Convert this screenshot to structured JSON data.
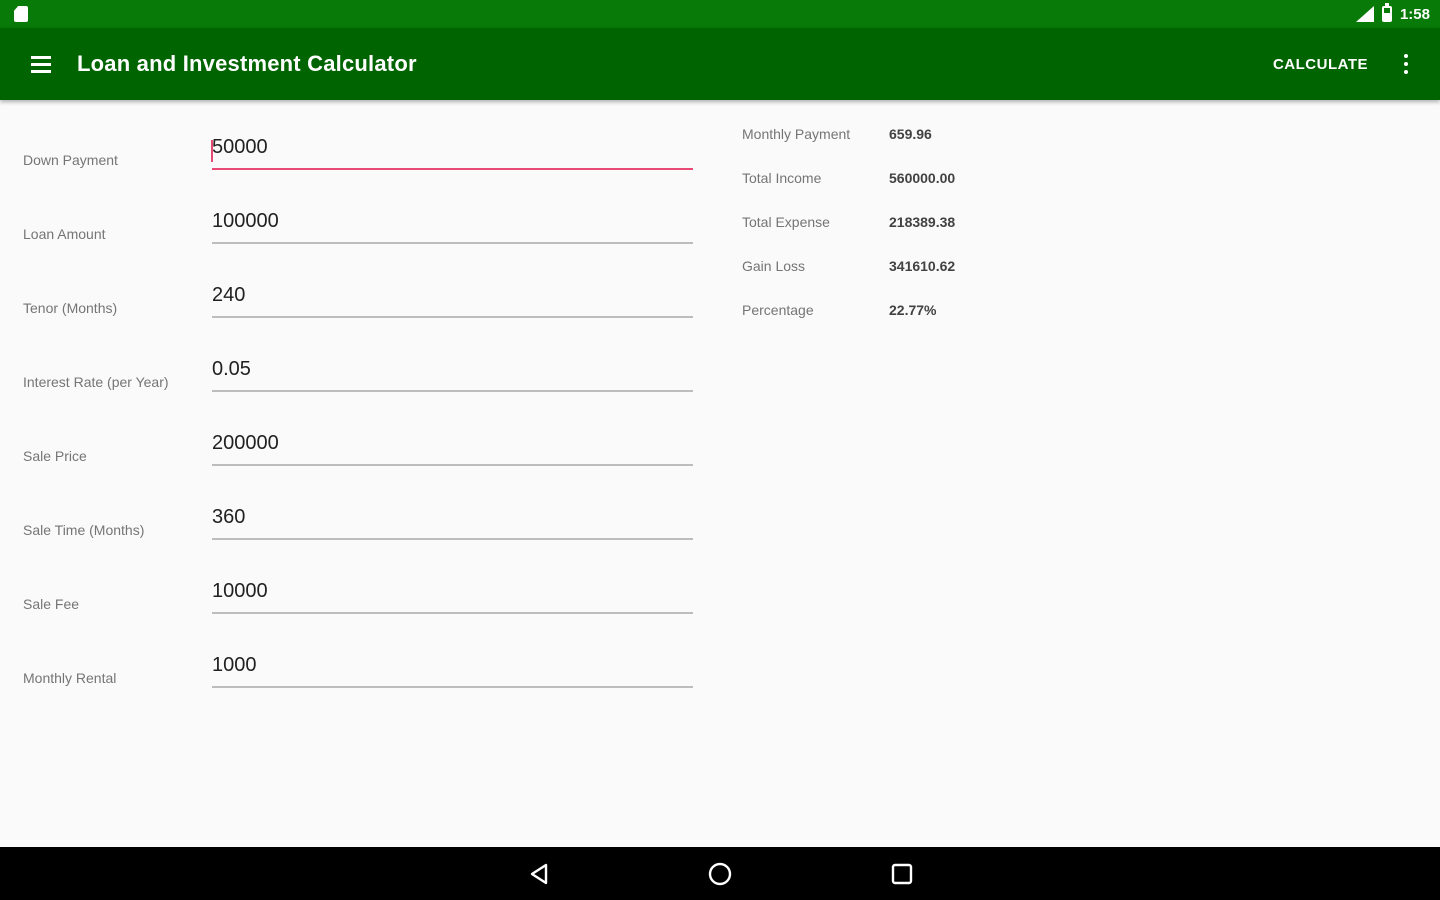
{
  "status_bar": {
    "time": "1:58",
    "icons": [
      "sd-card-icon",
      "signal-icon",
      "battery-icon"
    ]
  },
  "app_bar": {
    "title": "Loan and Investment Calculator",
    "calculate_label": "CALCULATE",
    "icons": [
      "menu-icon",
      "overflow-menu-icon"
    ]
  },
  "form": {
    "fields": [
      {
        "label": "Down Payment",
        "value": "50000"
      },
      {
        "label": "Loan Amount",
        "value": "100000"
      },
      {
        "label": "Tenor (Months)",
        "value": "240"
      },
      {
        "label": "Interest Rate (per Year)",
        "value": "0.05"
      },
      {
        "label": "Sale Price",
        "value": "200000"
      },
      {
        "label": "Sale Time (Months)",
        "value": "360"
      },
      {
        "label": "Sale Fee",
        "value": "10000"
      },
      {
        "label": "Monthly Rental",
        "value": "1000"
      }
    ]
  },
  "results": {
    "rows": [
      {
        "label": "Monthly Payment",
        "value": "659.96"
      },
      {
        "label": "Total Income",
        "value": "560000.00"
      },
      {
        "label": "Total Expense",
        "value": "218389.38"
      },
      {
        "label": "Gain Loss",
        "value": "341610.62"
      },
      {
        "label": "Percentage",
        "value": "22.77%"
      }
    ]
  },
  "nav_bar": {
    "icons": [
      "back-icon",
      "home-icon",
      "recents-icon"
    ]
  },
  "colors": {
    "status_bar": "#087a08",
    "app_bar": "#006400",
    "focus_accent": "#e84a75"
  }
}
